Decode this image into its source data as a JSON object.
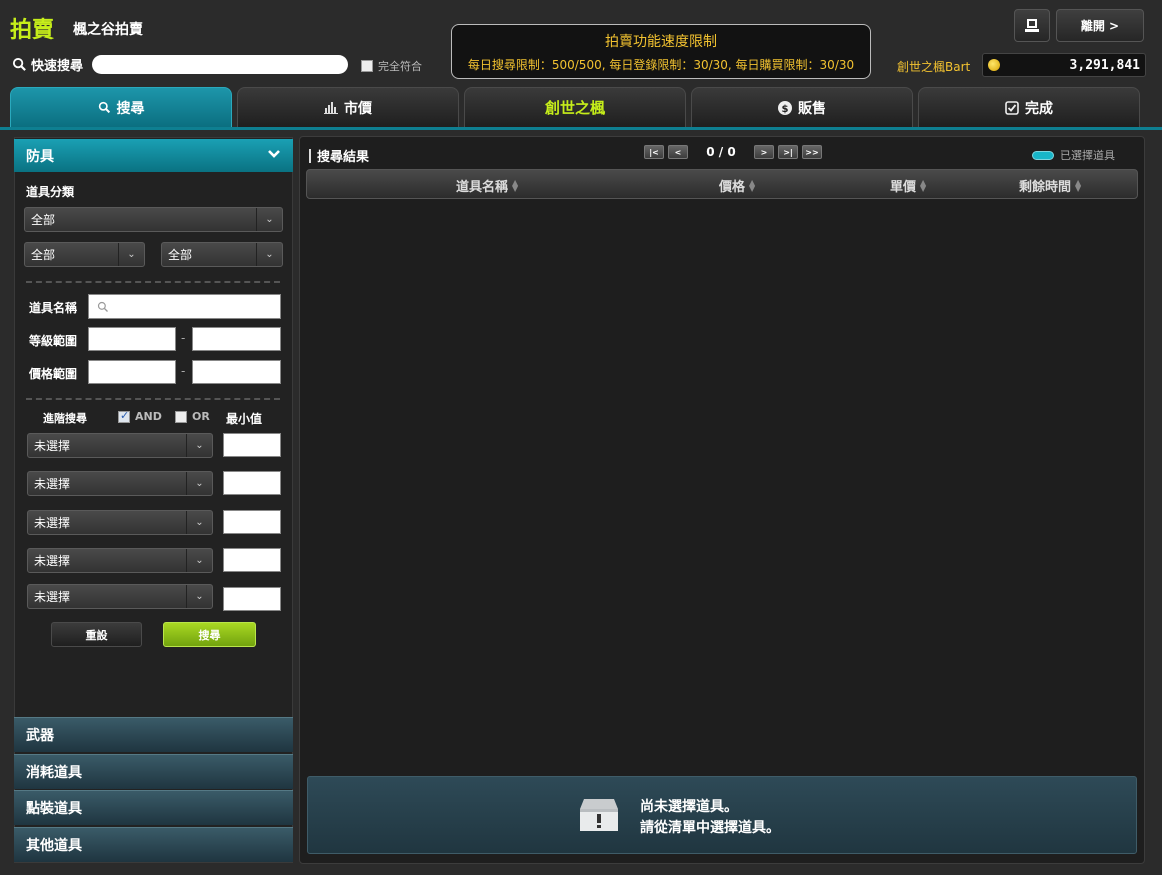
{
  "header": {
    "title": "拍賣",
    "subtitle": "楓之谷拍賣",
    "quick_search_label": "快速搜尋",
    "quick_search_value": "",
    "exact_match_label": "完全符合",
    "exit_label": "離開 >",
    "world_label": "創世之楓Bart",
    "mesos": "3,291,841"
  },
  "limits": {
    "title": "拍賣功能速度限制",
    "text": "每日搜尋限制：500/500, 每日登錄限制：30/30, 每日購買限制：30/30"
  },
  "tabs": [
    {
      "label": "搜尋",
      "icon": "search-icon",
      "active": true
    },
    {
      "label": "市價",
      "icon": "bar-chart-icon",
      "active": false
    },
    {
      "label": "創世之楓",
      "icon": "",
      "active": false
    },
    {
      "label": "販售",
      "icon": "dollar-icon",
      "active": false
    },
    {
      "label": "完成",
      "icon": "checkbox-icon",
      "active": false
    }
  ],
  "filter": {
    "category_title": "防具",
    "item_class_label": "道具分類",
    "select_main": "全部",
    "select_sub1": "全部",
    "select_sub2": "全部",
    "item_name_label": "道具名稱",
    "level_range_label": "等級範圍",
    "price_range_label": "價格範圍",
    "range_sep": "-",
    "advanced_label": "進階搜尋",
    "and_label": "AND",
    "or_label": "OR",
    "min_label": "最小值",
    "advanced_rows": [
      "未選擇",
      "未選擇",
      "未選擇",
      "未選擇",
      "未選擇"
    ],
    "reset_label": "重設",
    "search_label": "搜尋"
  },
  "categories": [
    "武器",
    "消耗道具",
    "點裝道具",
    "其他道具"
  ],
  "results": {
    "title": "搜尋結果",
    "page_text": "0 / 0",
    "legend_label": "已選擇道具",
    "columns": [
      "道具名稱",
      "價格",
      "單價",
      "剩餘時間"
    ],
    "empty_line1": "尚未選擇道具。",
    "empty_line2": "請從清單中選擇道具。"
  },
  "colors": {
    "accent_teal": "#0b7f91",
    "title_green": "#c6ee1a",
    "notice_gold": "#f2c230"
  }
}
